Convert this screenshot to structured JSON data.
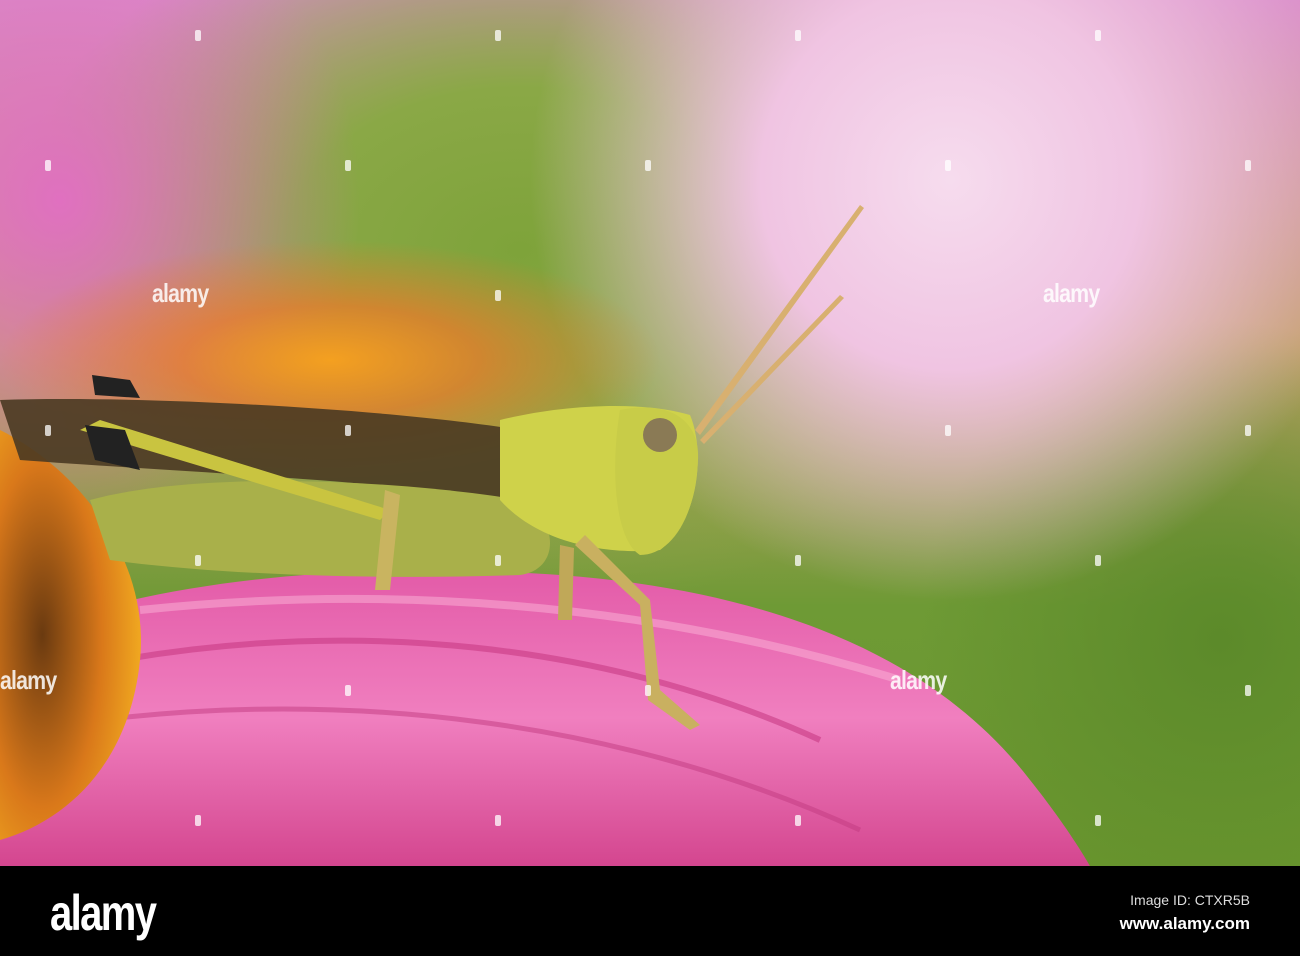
{
  "watermark": {
    "text": "alamy"
  },
  "footer": {
    "logo": "alamy",
    "image_id": "Image ID: CTXR5B",
    "website": "www.alamy.com"
  }
}
